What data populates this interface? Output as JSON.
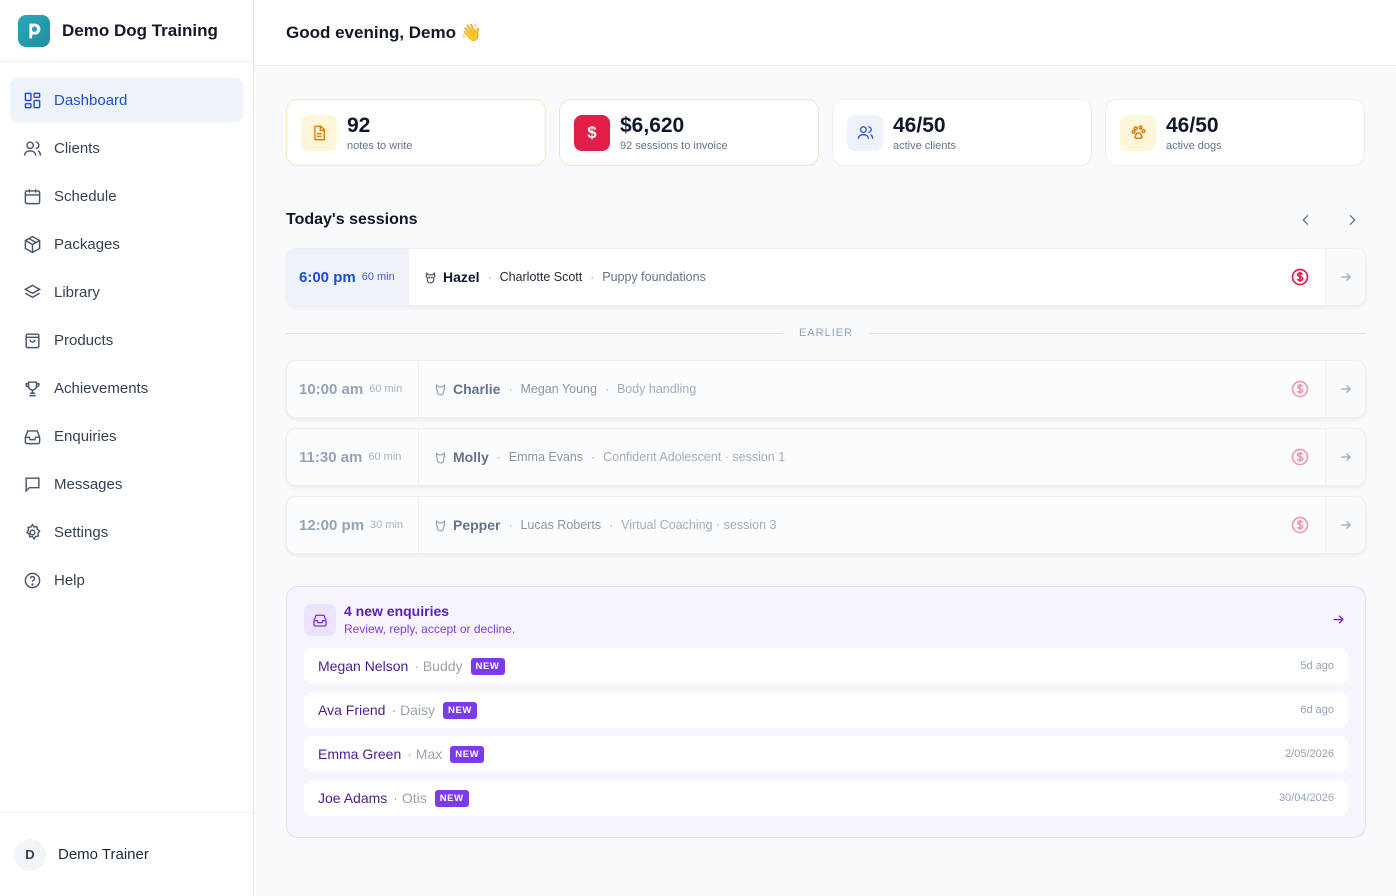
{
  "brand": {
    "name": "Demo Dog Training"
  },
  "nav": [
    {
      "label": "Dashboard",
      "icon": "dashboard-icon",
      "active": true
    },
    {
      "label": "Clients",
      "icon": "users-icon"
    },
    {
      "label": "Schedule",
      "icon": "calendar-icon"
    },
    {
      "label": "Packages",
      "icon": "package-icon"
    },
    {
      "label": "Library",
      "icon": "layers-icon"
    },
    {
      "label": "Products",
      "icon": "shopping-bag-icon"
    },
    {
      "label": "Achievements",
      "icon": "trophy-icon"
    },
    {
      "label": "Enquiries",
      "icon": "inbox-icon"
    },
    {
      "label": "Messages",
      "icon": "message-icon"
    },
    {
      "label": "Settings",
      "icon": "gear-icon"
    },
    {
      "label": "Help",
      "icon": "help-icon"
    }
  ],
  "user": {
    "initial": "D",
    "name": "Demo Trainer"
  },
  "header": {
    "greeting": "Good evening, Demo 👋"
  },
  "stats": [
    {
      "value": "92",
      "label": "notes to write",
      "icon": "document-icon"
    },
    {
      "value": "$6,620",
      "label": "92 sessions to invoice",
      "icon": "dollar-icon"
    },
    {
      "value": "46/50",
      "label": "active clients",
      "icon": "users-icon"
    },
    {
      "value": "46/50",
      "label": "active dogs",
      "icon": "paw-icon"
    }
  ],
  "sessions": {
    "title": "Today's sessions",
    "earlier_label": "EARLIER",
    "current": {
      "time": "6:00 pm",
      "duration": "60 min",
      "dog": "Hazel",
      "owner": "Charlotte Scott",
      "program": "Puppy foundations"
    },
    "earlier": [
      {
        "time": "10:00 am",
        "duration": "60 min",
        "dog": "Charlie",
        "owner": "Megan Young",
        "program": "Body handling"
      },
      {
        "time": "11:30 am",
        "duration": "60 min",
        "dog": "Molly",
        "owner": "Emma Evans",
        "program": "Confident Adolescent · session 1"
      },
      {
        "time": "12:00 pm",
        "duration": "30 min",
        "dog": "Pepper",
        "owner": "Lucas Roberts",
        "program": "Virtual Coaching · session 3"
      }
    ]
  },
  "enquiries": {
    "title": "4 new enquiries",
    "subtitle": "Review, reply, accept or decline.",
    "badge": "NEW",
    "items": [
      {
        "name": "Megan Nelson",
        "dog": "· Buddy",
        "time": "5d ago"
      },
      {
        "name": "Ava Friend",
        "dog": "· Daisy",
        "time": "6d ago"
      },
      {
        "name": "Emma Green",
        "dog": "· Max",
        "time": "2/05/2026"
      },
      {
        "name": "Joe Adams",
        "dog": "· Otis",
        "time": "30/04/2026"
      }
    ]
  },
  "colors": {
    "accent": "#1d4ed8",
    "danger": "#e11d48",
    "purple": "#7c3aed"
  }
}
